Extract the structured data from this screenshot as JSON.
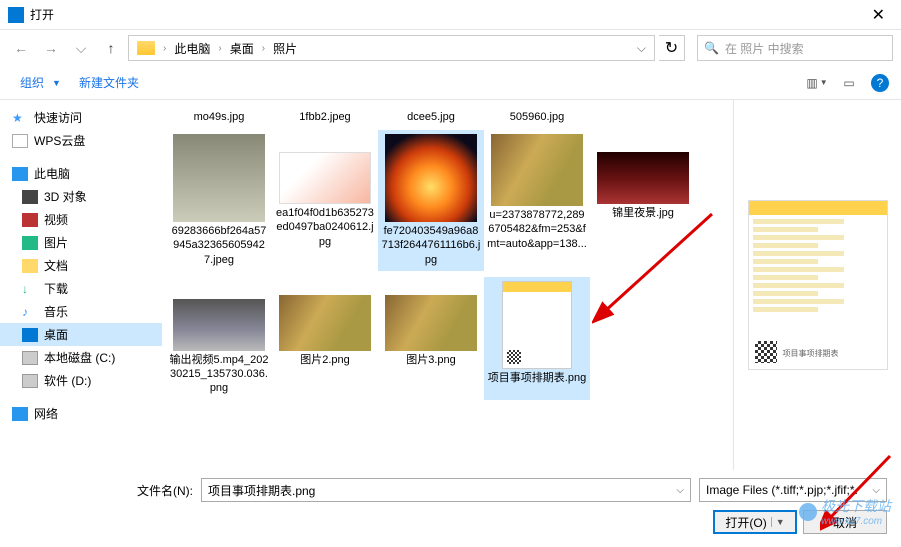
{
  "window": {
    "title": "打开"
  },
  "breadcrumb": {
    "root": "此电脑",
    "p1": "桌面",
    "p2": "照片"
  },
  "search": {
    "placeholder": "在 照片 中搜索"
  },
  "toolbar": {
    "organize": "组织",
    "new_folder": "新建文件夹"
  },
  "sidebar": {
    "quick": "快速访问",
    "wps": "WPS云盘",
    "pc": "此电脑",
    "d3d": "3D 对象",
    "video": "视频",
    "pic": "图片",
    "docs": "文档",
    "dl": "下载",
    "music": "音乐",
    "desk": "桌面",
    "diskc": "本地磁盘 (C:)",
    "diskd": "软件 (D:)",
    "net": "网络"
  },
  "row1": [
    "mo49s.jpg",
    "1fbb2.jpeg",
    "dcee5.jpg",
    "505960.jpg"
  ],
  "row2": [
    "69283666bf264a57945a323656059427.jpeg",
    "ea1f04f0d1b635273ed0497ba0240612.jpg",
    "fe720403549a96a8713f2644761116b6.jpg",
    "u=2373878772,2896705482&fm=253&fmt=auto&app=138...",
    "锦里夜景.jpg"
  ],
  "row3": [
    "输出视频5.mp4_20230215_135730.036.png",
    "图片2.png",
    "图片3.png",
    "项目事项排期表.png"
  ],
  "preview": {
    "caption": "项目事项排期表"
  },
  "footer": {
    "filename_label": "文件名(N):",
    "filename_value": "项目事项排期表.png",
    "filter": "Image Files (*.tiff;*.pjp;*.jfif;*.",
    "open": "打开(O)",
    "cancel": "取消"
  },
  "watermark": {
    "text": "极光下载站",
    "url": "www.xz7.com"
  }
}
